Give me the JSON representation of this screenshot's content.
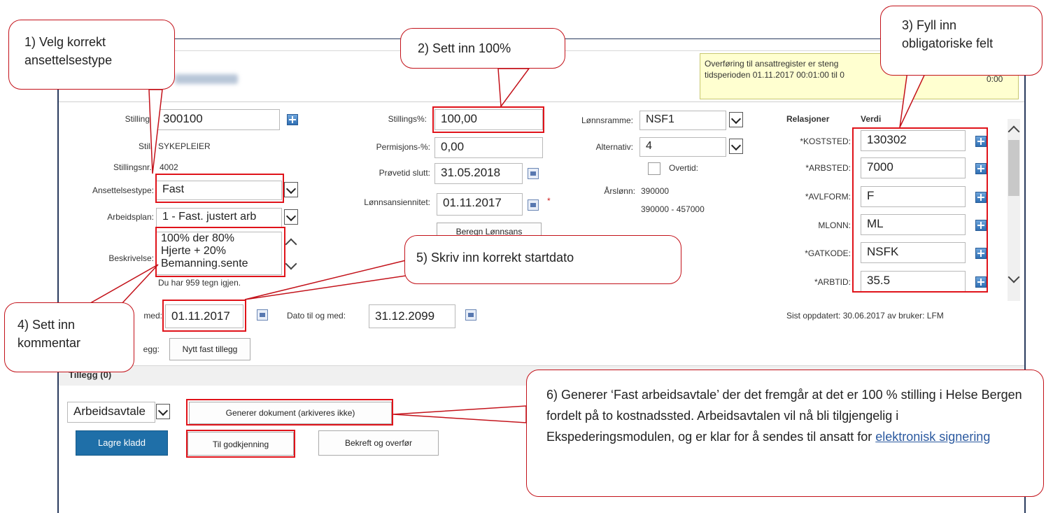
{
  "notice": {
    "line1": "Overføring til ansattregister er steng",
    "line2": "tidsperioden 01.11.2017 00:01:00 til 0",
    "line2_tail": "0:00"
  },
  "form": {
    "stillingsnr_label": "Stillings",
    "stillingsnr_value": "300100",
    "stilling_label": "Stilli",
    "stilling_value": "SYKEPLEIER",
    "stillingsnr2_label": "Stillingsnr.:",
    "stillingsnr2_value": "4002",
    "ansettelsestype_label": "Ansettelsestype:",
    "ansettelsestype_value": "Fast",
    "arbeidsplan_label": "Arbeidsplan:",
    "arbeidsplan_value": "1 - Fast. justert arb",
    "beskrivelse_label": "Beskrivelse:",
    "beskrivelse_lines": [
      "100% der 80%",
      "Hjerte + 20%",
      "Bemanning.sente"
    ],
    "tegn_igjen": "Du har 959 tegn igjen.",
    "stillingspct_label": "Stillings%:",
    "stillingspct_value": "100,00",
    "permisjon_label": "Permisjons-%:",
    "permisjon_value": "0,00",
    "provetid_label": "Prøvetid slutt:",
    "provetid_value": "31.05.2018",
    "lonnsans_label": "Lønnsansiennitet:",
    "lonnsans_value": "01.11.2017",
    "required_star": "*",
    "beregn_button": "Beregn Lønnsans",
    "lonnsramme_label": "Lønnsramme:",
    "lonnsramme_value": "NSF1",
    "alternativ_label": "Alternativ:",
    "alternativ_value": "4",
    "overtid_label": "Overtid:",
    "arslonn_label": "Årslønn:",
    "arslonn_value": "390000",
    "arslonn_range": "390000 - 457000",
    "dato_fra_label": "med:",
    "dato_fra_value": "01.11.2017",
    "dato_til_label": "Dato til og med:",
    "dato_til_value": "31.12.2099",
    "tillegg_label": "egg:",
    "nytt_tillegg_button": "Nytt fast tillegg"
  },
  "relasjoner": {
    "header_rel": "Relasjoner",
    "header_verdi": "Verdi",
    "rows": [
      {
        "label": "*KOSTSTED:",
        "value": "130302"
      },
      {
        "label": "*ARBSTED:",
        "value": "7000"
      },
      {
        "label": "*AVLFORM:",
        "value": "F"
      },
      {
        "label": "MLONN:",
        "value": "ML"
      },
      {
        "label": "*GATKODE:",
        "value": "NSFK"
      },
      {
        "label": "*ARBTID:",
        "value": "35.5"
      }
    ],
    "sist_oppdatert": "Sist oppdatert: 30.06.2017 av bruker: LFM"
  },
  "tillegg": {
    "title": "Tillegg (0)",
    "dokument_select": "Arbeidsavtale",
    "generer_button": "Generer dokument (arkiveres ikke)",
    "lagre_button": "Lagre kladd",
    "godkjenning_button": "Til godkjenning",
    "bekreft_button": "Bekreft og overfør"
  },
  "callouts": {
    "c1": "1) Velg korrekt ansettelsestype",
    "c2": "2) Sett inn 100%",
    "c3": "3) Fyll inn obligatoriske felt",
    "c4": "4) Sett inn kommentar",
    "c5": "5) Skriv inn korrekt startdato",
    "c6_text": "6) Generer ‘Fast arbeidsavtale’ der det fremgår at det er 100 % stilling i Helse Bergen fordelt på to kostnadssted. Arbeidsavtalen vil nå bli tilgjengelig i Ekspederingsmodulen, og er klar for å sendes til ansatt for ",
    "c6_link": "elektronisk signering"
  },
  "colors": {
    "annotation_red": "#e0131a",
    "primary_button": "#1f6fa8",
    "notice_bg": "#ffffd0"
  }
}
